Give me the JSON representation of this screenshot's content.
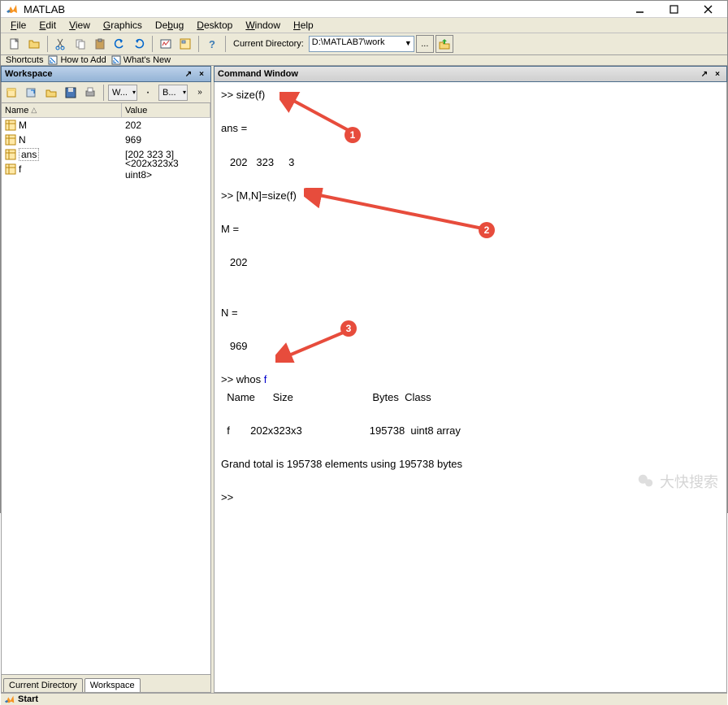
{
  "title": "MATLAB",
  "menu": {
    "file": "File",
    "edit": "Edit",
    "view": "View",
    "graphics": "Graphics",
    "debug": "Debug",
    "desktop": "Desktop",
    "window": "Window",
    "help": "Help"
  },
  "toolbar": {
    "dirlabel": "Current Directory:",
    "dirvalue": "D:\\MATLAB7\\work"
  },
  "shortcuts": {
    "label": "Shortcuts",
    "howto": "How to Add",
    "whatsnew": "What's New"
  },
  "workspace": {
    "title": "Workspace",
    "combo1": "W...",
    "combo2": "B...",
    "head_name": "Name",
    "head_sort": "▲",
    "head_value": "Value",
    "rows": [
      {
        "name": "M",
        "value": "202"
      },
      {
        "name": "N",
        "value": "969"
      },
      {
        "name": "ans",
        "value": "[202 323 3]"
      },
      {
        "name": "f",
        "value": "<202x323x3 uint8>"
      }
    ],
    "tab_cd": "Current Directory",
    "tab_ws": "Workspace"
  },
  "cmdwin": {
    "title": "Command Window",
    "l1": ">> size(f)",
    "l2": "ans =",
    "l3": "   202   323     3",
    "l4": ">> [M,N]=size(f)",
    "l5": "M =",
    "l6": "   202",
    "l7": "N =",
    "l8": "   969",
    "l9p": ">> whos ",
    "l9b": "f",
    "l10": "  Name      Size                           Bytes  Class",
    "l11": "  f       202x323x3                       195738  uint8 array",
    "l12": "Grand total is 195738 elements using 195738 bytes",
    "l13": ">> "
  },
  "callouts": {
    "c1": "1",
    "c2": "2",
    "c3": "3"
  },
  "status": {
    "start": "Start"
  },
  "watermark": "大快搜索"
}
